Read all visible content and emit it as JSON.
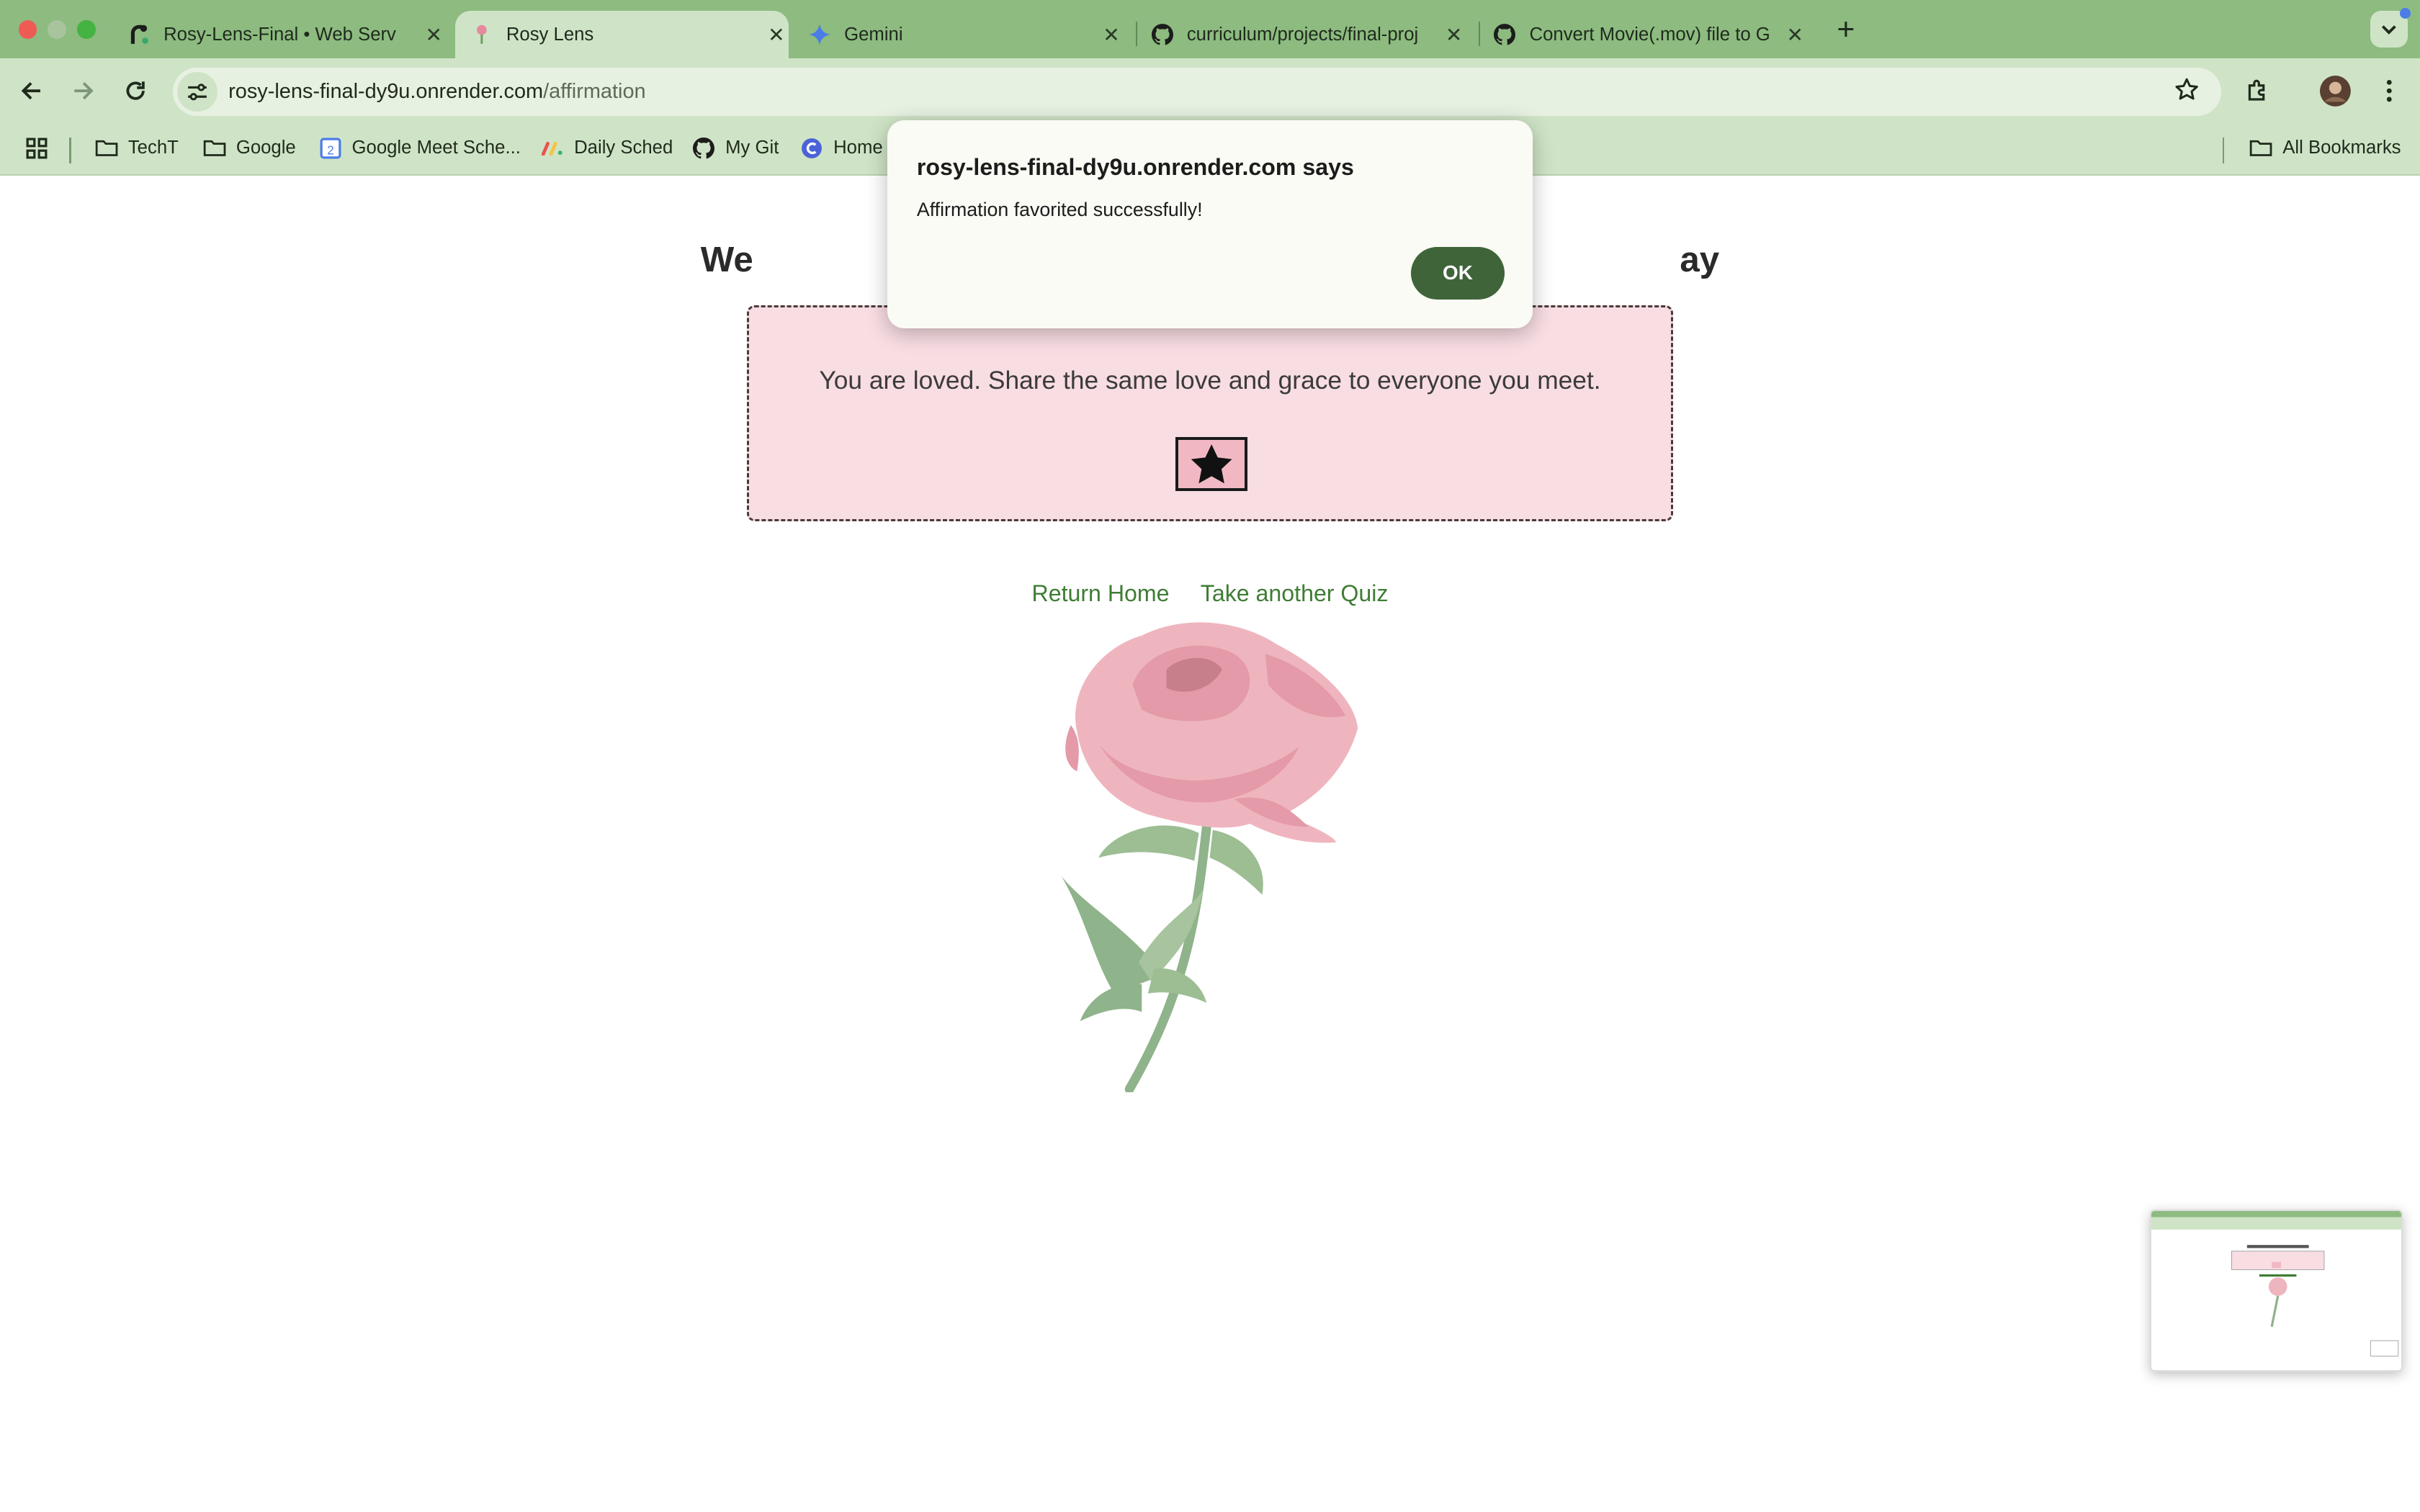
{
  "tabs": [
    {
      "title": "Rosy-Lens-Final • Web Serv",
      "icon": "render-icon"
    },
    {
      "title": "Rosy Lens",
      "icon": "rose-favicon"
    },
    {
      "title": "Gemini",
      "icon": "gemini-icon"
    },
    {
      "title": "curriculum/projects/final-proj",
      "icon": "github-icon"
    },
    {
      "title": "Convert Movie(.mov) file to G",
      "icon": "github-icon"
    }
  ],
  "url": {
    "host": "rosy-lens-final-dy9u.onrender.com",
    "path": "/affirmation"
  },
  "bookmarks": [
    "TechT",
    "Google",
    "Google Meet Sche...",
    "Daily Sched",
    "My Git",
    "Home",
    "All Bookmarks"
  ],
  "page": {
    "heading": "We                                                                                              ay",
    "affirmation": "You are loved. Share the same love and grace to everyone you meet.",
    "links": [
      "Return Home",
      "Take another Quiz"
    ]
  },
  "dialog": {
    "title": "rosy-lens-final-dy9u.onrender.com says",
    "message": "Affirmation favorited successfully!",
    "ok_label": "OK"
  },
  "colors": {
    "accent_green": "#3f643a",
    "card_pink": "#f8dde3",
    "link_green": "#3f7d35"
  }
}
